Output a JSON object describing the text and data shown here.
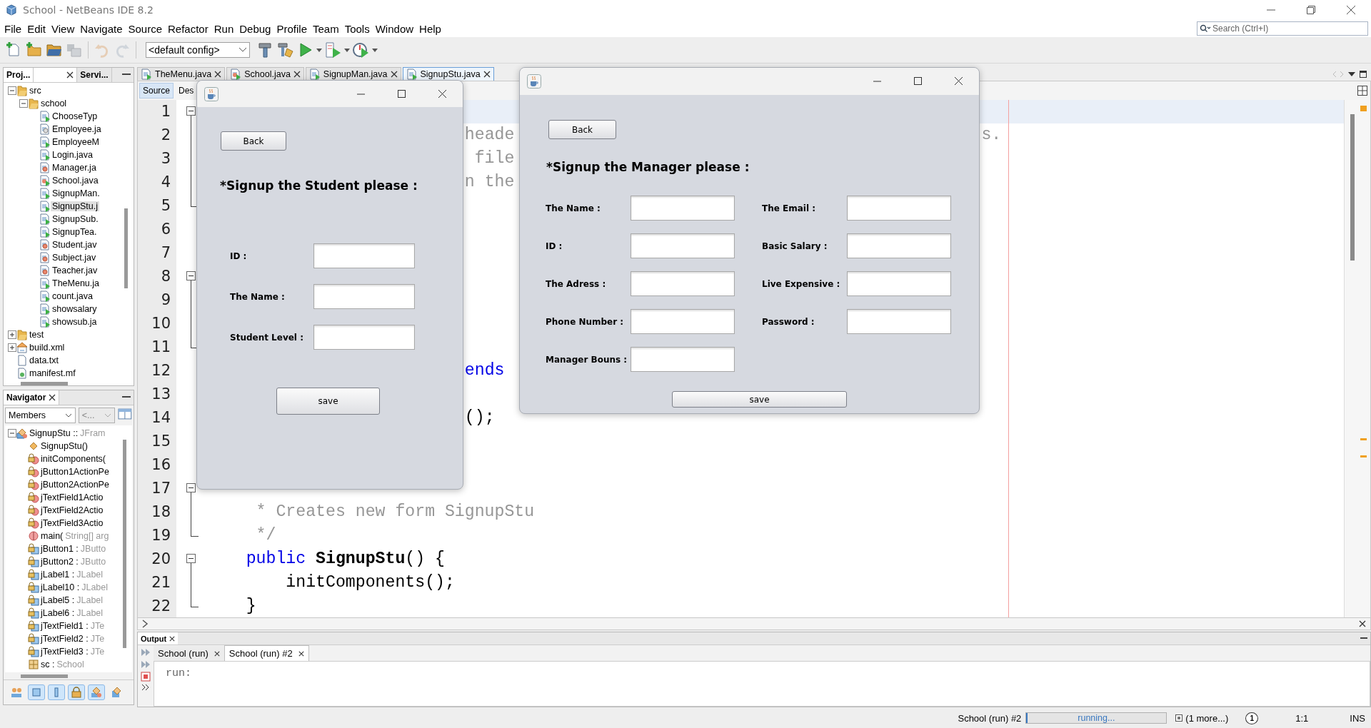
{
  "window": {
    "title": "School - NetBeans IDE 8.2"
  },
  "menu": [
    "File",
    "Edit",
    "View",
    "Navigate",
    "Source",
    "Refactor",
    "Run",
    "Debug",
    "Profile",
    "Team",
    "Tools",
    "Window",
    "Help"
  ],
  "search": {
    "placeholder": "Search (Ctrl+I)"
  },
  "toolbar": {
    "buttons": [
      {
        "kind": "new-file",
        "disabled": false
      },
      {
        "kind": "new-project",
        "disabled": false
      },
      {
        "kind": "open-project",
        "disabled": false
      },
      {
        "kind": "close-project",
        "disabled": true
      },
      {
        "kind": "undo",
        "disabled": true
      },
      {
        "kind": "redo",
        "disabled": true
      }
    ],
    "config": "<default config>",
    "actions": [
      {
        "kind": "build",
        "dropdown": false
      },
      {
        "kind": "clean-build",
        "dropdown": false
      },
      {
        "kind": "run",
        "dropdown": true
      },
      {
        "kind": "debug",
        "dropdown": true
      },
      {
        "kind": "profile",
        "dropdown": true
      }
    ]
  },
  "projects": {
    "tabs": [
      {
        "label": "Proj...",
        "selected": true
      },
      {
        "label": "Servi...",
        "selected": false
      }
    ],
    "tree": [
      {
        "label": "src",
        "kind": "folder",
        "expanded": true,
        "selected": false,
        "children": [
          {
            "label": "school",
            "kind": "folder",
            "expanded": true,
            "selected": false,
            "children": [
              {
                "label": "ChooseTyp",
                "kind": "form",
                "selected": false
              },
              {
                "label": "Employee.ja",
                "kind": "class",
                "selected": false
              },
              {
                "label": "EmployeeM",
                "kind": "form",
                "selected": false
              },
              {
                "label": "Login.java",
                "kind": "form",
                "selected": false
              },
              {
                "label": "Manager.ja",
                "kind": "bean",
                "selected": false
              },
              {
                "label": "School.java",
                "kind": "main-class",
                "selected": false
              },
              {
                "label": "SignupMan.",
                "kind": "form",
                "selected": false
              },
              {
                "label": "SignupStu.j",
                "kind": "form",
                "selected": true
              },
              {
                "label": "SignupSub.",
                "kind": "form",
                "selected": false
              },
              {
                "label": "SignupTea.",
                "kind": "form",
                "selected": false
              },
              {
                "label": "Student.jav",
                "kind": "bean",
                "selected": false
              },
              {
                "label": "Subject.jav",
                "kind": "bean",
                "selected": false
              },
              {
                "label": "Teacher.jav",
                "kind": "bean",
                "selected": false
              },
              {
                "label": "TheMenu.ja",
                "kind": "form",
                "selected": false
              },
              {
                "label": "count.java",
                "kind": "form",
                "selected": false
              },
              {
                "label": "showsalary",
                "kind": "form",
                "selected": false
              },
              {
                "label": "showsub.ja",
                "kind": "form",
                "selected": false
              }
            ]
          }
        ]
      },
      {
        "label": "test",
        "kind": "folder",
        "expanded": false,
        "selected": false
      },
      {
        "label": "build.xml",
        "kind": "xml-file",
        "expanded": false,
        "selected": false
      },
      {
        "label": "data.txt",
        "kind": "text-file",
        "selected": false
      },
      {
        "label": "manifest.mf",
        "kind": "manifest-file",
        "selected": false
      }
    ]
  },
  "navigator": {
    "title": "Navigator",
    "filter": "Members",
    "secondary": {
      "value": "<...",
      "disabled": true
    },
    "tree": [
      {
        "label": "SignupStu ::",
        "type": "JFram",
        "kind": "class",
        "expanded": true,
        "selected": false,
        "children": [
          {
            "label": "SignupStu()",
            "kind": "constructor",
            "selected": false
          },
          {
            "label": "initComponents(",
            "kind": "private-method",
            "selected": false
          },
          {
            "label": "jButton1ActionPe",
            "kind": "private-method",
            "selected": false
          },
          {
            "label": "jButton2ActionPe",
            "kind": "private-method",
            "selected": false
          },
          {
            "label": "jTextField1Actio",
            "kind": "private-method",
            "selected": false
          },
          {
            "label": "jTextField2Actio",
            "kind": "private-method",
            "selected": false
          },
          {
            "label": "jTextField3Actio",
            "kind": "private-method",
            "selected": false
          },
          {
            "label": "main(",
            "type": "String[] arg",
            "kind": "static-method",
            "selected": false
          },
          {
            "label": "jButton1 :",
            "type": "JButto",
            "kind": "private-field",
            "selected": false
          },
          {
            "label": "jButton2 :",
            "type": "JButto",
            "kind": "private-field",
            "selected": false
          },
          {
            "label": "jLabel1 :",
            "type": "JLabel",
            "kind": "private-field",
            "selected": false
          },
          {
            "label": "jLabel10 :",
            "type": "JLabel",
            "kind": "private-field",
            "selected": false
          },
          {
            "label": "jLabel5 :",
            "type": "JLabel",
            "kind": "private-field",
            "selected": false
          },
          {
            "label": "jLabel6 :",
            "type": "JLabel",
            "kind": "private-field",
            "selected": false
          },
          {
            "label": "jTextField1 :",
            "type": "JTe",
            "kind": "private-field",
            "selected": false
          },
          {
            "label": "jTextField2 :",
            "type": "JTe",
            "kind": "private-field",
            "selected": false
          },
          {
            "label": "jTextField3 :",
            "type": "JTe",
            "kind": "private-field",
            "selected": false
          },
          {
            "label": "sc :",
            "type": "School",
            "kind": "field",
            "selected": false
          }
        ]
      }
    ],
    "filters": [
      {
        "kind": "inherited",
        "selected": false
      },
      {
        "kind": "fields",
        "selected": true
      },
      {
        "kind": "static",
        "selected": true
      },
      {
        "kind": "non-public",
        "selected": true
      },
      {
        "kind": "local-classes",
        "selected": true
      },
      {
        "kind": "fq-names",
        "selected": false
      }
    ]
  },
  "editor": {
    "tabs": [
      {
        "label": "TheMenu.java",
        "kind": "form",
        "selected": false
      },
      {
        "label": "School.java",
        "kind": "main-class",
        "selected": false
      },
      {
        "label": "SignupMan.java",
        "kind": "form",
        "selected": false
      },
      {
        "label": "SignupStu.java",
        "kind": "form",
        "selected": true
      }
    ],
    "views": [
      {
        "label": "Source",
        "selected": true
      },
      {
        "label": "Des",
        "selected": false
      }
    ],
    "lines": [
      {
        "number": "1",
        "kind": "fold-start",
        "current": true
      },
      {
        "number": "2",
        "kind": "fold-inside",
        "current": false,
        "segments": [
          {
            "text": "                          heade",
            "kind": "comment"
          },
          {
            "text": "                                               s.",
            "kind": "comment"
          }
        ]
      },
      {
        "number": "3",
        "kind": "fold-inside",
        "current": false,
        "segments": [
          {
            "text": "                           file",
            "kind": "comment"
          }
        ]
      },
      {
        "number": "4",
        "kind": "fold-inside",
        "current": false,
        "segments": [
          {
            "text": "                          n the",
            "kind": "comment"
          }
        ]
      },
      {
        "number": "5",
        "kind": "fold-end",
        "current": false
      },
      {
        "number": "6",
        "kind": "plain",
        "current": false
      },
      {
        "number": "7",
        "kind": "plain",
        "current": false
      },
      {
        "number": "8",
        "kind": "fold-start",
        "current": false
      },
      {
        "number": "9",
        "kind": "fold-inside",
        "current": false
      },
      {
        "number": "10",
        "kind": "fold-inside",
        "current": false
      },
      {
        "number": "11",
        "kind": "fold-end",
        "current": false
      },
      {
        "number": "12",
        "kind": "plain",
        "current": false,
        "segments": [
          {
            "text": "                          ends",
            "kind": "keyword"
          }
        ]
      },
      {
        "number": "13",
        "kind": "plain",
        "current": false
      },
      {
        "number": "14",
        "kind": "plain",
        "current": false,
        "segments": [
          {
            "text": "                          ();",
            "kind": "plain"
          }
        ]
      },
      {
        "number": "15",
        "kind": "plain",
        "current": false
      },
      {
        "number": "16",
        "kind": "plain",
        "current": false
      },
      {
        "number": "17",
        "kind": "fold-start",
        "current": false
      },
      {
        "number": "18",
        "kind": "fold-inside",
        "current": false,
        "segments": [
          {
            "text": "     * Creates new form SignupStu",
            "kind": "comment"
          }
        ]
      },
      {
        "number": "19",
        "kind": "fold-end",
        "current": false,
        "segments": [
          {
            "text": "     */",
            "kind": "comment"
          }
        ]
      },
      {
        "number": "20",
        "kind": "fold-start",
        "current": false,
        "segments": [
          {
            "text": "    public",
            "kind": "keyword"
          },
          {
            "text": " SignupStu",
            "kind": "bold"
          },
          {
            "text": "() {",
            "kind": "plain"
          }
        ]
      },
      {
        "number": "21",
        "kind": "fold-inside",
        "current": false,
        "segments": [
          {
            "text": "        initComponents();",
            "kind": "plain"
          }
        ]
      },
      {
        "number": "22",
        "kind": "fold-end",
        "current": false,
        "segments": [
          {
            "text": "    }",
            "kind": "plain"
          }
        ]
      }
    ]
  },
  "dialogs": [
    {
      "kind": "one-column",
      "back": "Back",
      "heading": "*Signup the Student please :",
      "fields": [
        {
          "label": "ID :"
        },
        {
          "label": "The Name :"
        },
        {
          "label": "Student Level :"
        }
      ],
      "save": "save"
    },
    {
      "kind": "two-column",
      "back": "Back",
      "heading": "*Signup the Manager please :",
      "fields": [
        {
          "label": "The Name :"
        },
        {
          "label": "The Email :"
        },
        {
          "label": "ID :"
        },
        {
          "label": "Basic Salary :"
        },
        {
          "label": "The Adress :"
        },
        {
          "label": "Live Expensive :"
        },
        {
          "label": "Phone Number :"
        },
        {
          "label": "Password :"
        },
        {
          "label": "Manager Bouns :"
        }
      ],
      "save": "save"
    }
  ],
  "output": {
    "title": "Output",
    "tabs": [
      {
        "label": "School (run)",
        "selected": false
      },
      {
        "label": "School (run) #2",
        "selected": true
      }
    ],
    "text": "run:"
  },
  "status_bar": {
    "task": "School (run) #2",
    "progress": {
      "text": "running...",
      "level": 0.01
    },
    "more": "(1 more...)",
    "notifications": "1",
    "position": "1:1",
    "mode": "INS"
  }
}
